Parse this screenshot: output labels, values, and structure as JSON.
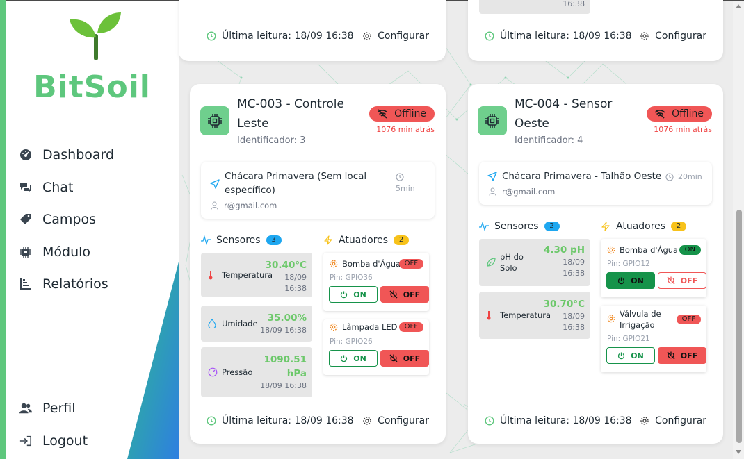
{
  "app": {
    "brand": "BitSoil",
    "brand_color": "#5ec77d"
  },
  "sidebar": {
    "items": [
      {
        "label": "Dashboard",
        "icon": "gauge-icon"
      },
      {
        "label": "Chat",
        "icon": "chat-icon"
      },
      {
        "label": "Campos",
        "icon": "tag-icon"
      },
      {
        "label": "Módulo",
        "icon": "chip-icon"
      },
      {
        "label": "Relatórios",
        "icon": "bar-chart-icon"
      }
    ],
    "bottom": [
      {
        "label": "Perfil",
        "icon": "users-icon"
      },
      {
        "label": "Logout",
        "icon": "logout-icon"
      }
    ]
  },
  "top_cards": [
    {
      "footer_reading": "Última leitura: 18/09 16:38",
      "footer_config": "Configurar"
    },
    {
      "footer_reading": "Última leitura: 18/09 16:38",
      "footer_config": "Configurar",
      "stub_text": "16:38"
    }
  ],
  "cards": [
    {
      "title_line1": "MC-003 - Controle",
      "title_line2": "Leste",
      "identifier": "Identificador: 3",
      "status": "Offline",
      "since": "1076 min atrás",
      "location_line1": "Chácara Primavera (Sem local",
      "location_line2": "específico)",
      "location_time": "5min",
      "user": "r@gmail.com",
      "sensors_label": "Sensores",
      "sensors_count": "3",
      "actuators_label": "Atuadores",
      "actuators_count": "2",
      "sensors": [
        {
          "name": "Temperatura",
          "value": "30.40°C",
          "date": "18/09",
          "time": "16:38"
        },
        {
          "name": "Umidade",
          "value": "35.00%",
          "datetime": "18/09 16:38"
        },
        {
          "name": "Pressão",
          "value_line1": "1090.51",
          "value_line2": "hPa",
          "datetime": "18/09 16:38"
        }
      ],
      "actuators": [
        {
          "name": "Bomba d'Água",
          "state": "OFF",
          "pin": "Pin: GPIO36",
          "on_label": "ON",
          "off_label": "OFF"
        },
        {
          "name": "Lâmpada LED",
          "state": "OFF",
          "pin": "Pin: GPIO26",
          "on_label": "ON",
          "off_label": "OFF"
        }
      ],
      "footer_reading": "Última leitura: 18/09 16:38",
      "footer_config": "Configurar"
    },
    {
      "title_line1": "MC-004 - Sensor",
      "title_line2": "Oeste",
      "identifier": "Identificador: 4",
      "status": "Offline",
      "since": "1076 min atrás",
      "location_line1": "Chácara Primavera - Talhão Oeste",
      "location_time": "20min",
      "user": "r@gmail.com",
      "sensors_label": "Sensores",
      "sensors_count": "2",
      "actuators_label": "Atuadores",
      "actuators_count": "2",
      "sensors": [
        {
          "name_line1": "pH do",
          "name_line2": "Solo",
          "value": "4.30 pH",
          "date": "18/09",
          "time": "16:38"
        },
        {
          "name": "Temperatura",
          "value": "30.70°C",
          "date": "18/09",
          "time": "16:38"
        }
      ],
      "actuators": [
        {
          "name": "Bomba d'Água",
          "state": "ON",
          "pin": "Pin: GPIO12",
          "on_label": "ON",
          "off_label": "OFF"
        },
        {
          "name_line1": "Válvula de",
          "name_line2": "Irrigação",
          "state": "OFF",
          "pin": "Pin: GPIO21",
          "on_label": "ON",
          "off_label": "OFF"
        }
      ],
      "footer_reading": "Última leitura: 18/09 16:38",
      "footer_config": "Configurar"
    }
  ],
  "colors": {
    "offline": "#f05656",
    "on": "#16934a",
    "value": "#6cc86a",
    "badge_blue": "#1ea7f0",
    "badge_yellow": "#f7c21b"
  }
}
